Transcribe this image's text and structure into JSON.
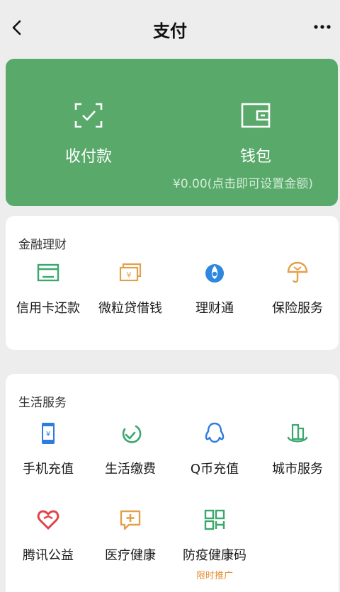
{
  "header": {
    "title": "支付"
  },
  "wallet_card": {
    "pay_label": "收付款",
    "wallet_label": "钱包",
    "balance_text": "¥0.00(点击即可设置金额)"
  },
  "finance": {
    "title": "金融理财",
    "items": [
      {
        "label": "信用卡还款",
        "icon": "credit-card-icon"
      },
      {
        "label": "微粒贷借钱",
        "icon": "yuan-bill-icon"
      },
      {
        "label": "理财通",
        "icon": "wealth-drop-icon"
      },
      {
        "label": "保险服务",
        "icon": "umbrella-shield-icon"
      }
    ]
  },
  "life": {
    "title": "生活服务",
    "items": [
      {
        "label": "手机充值",
        "icon": "phone-icon"
      },
      {
        "label": "生活缴费",
        "icon": "leaf-check-icon"
      },
      {
        "label": "Q币充值",
        "icon": "penguin-icon"
      },
      {
        "label": "城市服务",
        "icon": "city-icon"
      },
      {
        "label": "腾讯公益",
        "icon": "heart-icon"
      },
      {
        "label": "医疗健康",
        "icon": "medical-icon"
      },
      {
        "label": "防疫健康码",
        "icon": "qr-code-icon",
        "promo": "限时推广"
      }
    ]
  },
  "colors": {
    "green": "#58a96a",
    "promo": "#e8913a"
  }
}
